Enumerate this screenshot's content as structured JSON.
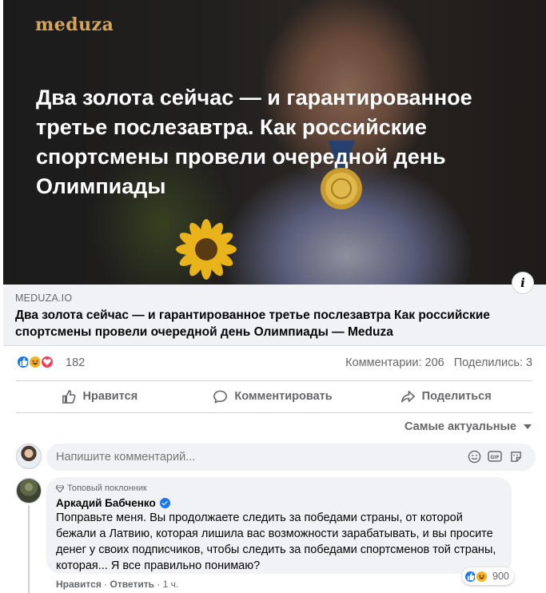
{
  "hero": {
    "logo": "meduza",
    "headline": "Два золота сейчас — и гарантированное третье послезавтра. Как российские спортсмены провели очередной день Олимпиады"
  },
  "link": {
    "domain": "MEDUZA.IO",
    "title": "Два золота сейчас — и гарантированное третье послезавтра Как российские спортсмены провели очередной день Олимпиады — Meduza"
  },
  "stats": {
    "reaction_count": "182",
    "comments": "Комментарии: 206",
    "shares": "Поделились: 3"
  },
  "actions": {
    "like": "Нравится",
    "comment": "Комментировать",
    "share": "Поделиться"
  },
  "sort": {
    "label": "Самые актуальные"
  },
  "composer": {
    "placeholder": "Напишите комментарий..."
  },
  "comment": {
    "badge": "Топовый поклонник",
    "author": "Аркадий Бабченко",
    "text": "Поправьте меня. Вы продолжаете следить за победами страны, от которой бежали а Латвию, которая лишила вас возможности зарабатывать, и вы просите денег у своих подписчиков, чтобы следить за победами спортсменов той страны, которая... Я все правильно понимаю?",
    "reaction_count": "900",
    "like": "Нравится",
    "sep1": "·",
    "reply": "Ответить",
    "sep2": "·",
    "time": "1 ч."
  },
  "colors": {
    "accent": "#1877f2",
    "logo": "#d3a65a",
    "secondary_text": "#65676b",
    "surface": "#f0f2f5"
  },
  "icons": [
    "info-icon",
    "like-reaction-icon",
    "haha-reaction-icon",
    "love-reaction-icon",
    "thumbs-up-icon",
    "comment-icon",
    "share-icon",
    "emoji-icon",
    "gif-icon",
    "sticker-icon",
    "diamond-icon",
    "verified-icon",
    "caret-down-icon"
  ]
}
